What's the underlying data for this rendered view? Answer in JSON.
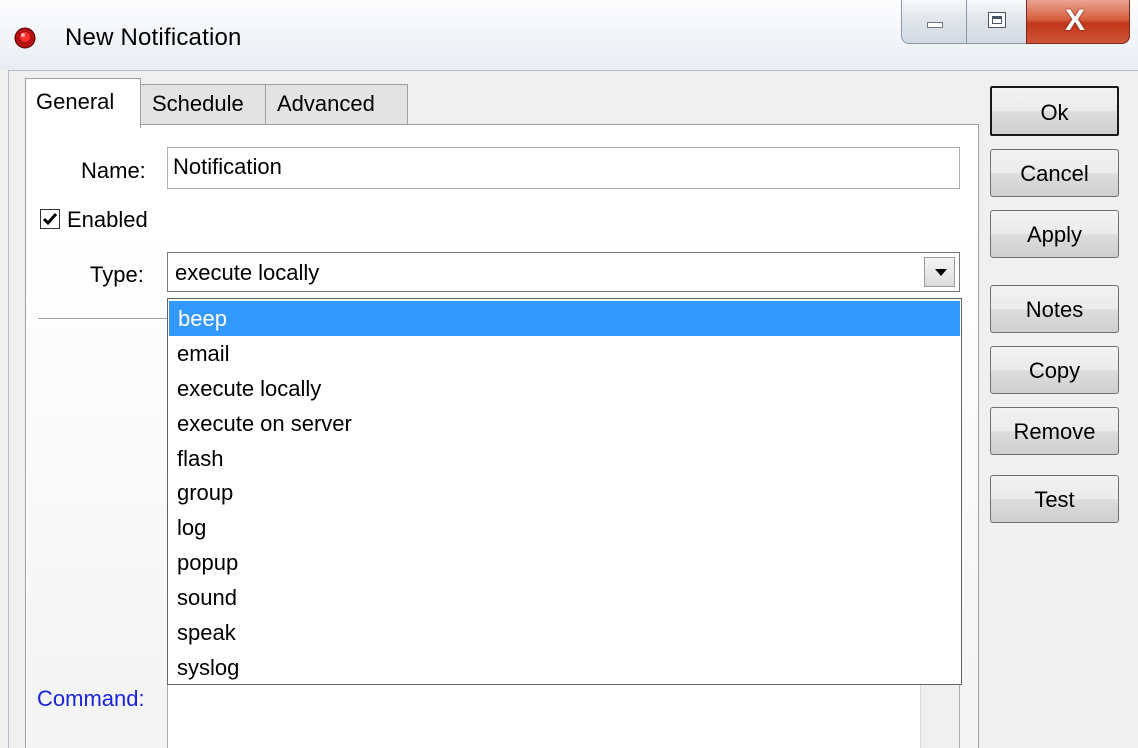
{
  "window": {
    "title": "New Notification",
    "app_icon": "red-alert-icon",
    "caption_buttons": {
      "minimize": "minimize-icon",
      "maximize": "maximize-icon",
      "close": "close-icon"
    }
  },
  "tabs": [
    {
      "label": "General",
      "active": true
    },
    {
      "label": "Schedule",
      "active": false
    },
    {
      "label": "Advanced",
      "active": false
    }
  ],
  "form": {
    "name_label": "Name:",
    "name_value": "Notification",
    "enabled_label": "Enabled",
    "enabled_checked": true,
    "type_label": "Type:",
    "type_value": "execute locally",
    "command_label": "Command:",
    "command_value": ""
  },
  "type_options": [
    "beep",
    "email",
    "execute locally",
    "execute on server",
    "flash",
    "group",
    "log",
    "popup",
    "sound",
    "speak",
    "syslog"
  ],
  "type_highlighted": "beep",
  "buttons": {
    "ok": "Ok",
    "cancel": "Cancel",
    "apply": "Apply",
    "notes": "Notes",
    "copy": "Copy",
    "remove": "Remove",
    "test": "Test"
  },
  "colors": {
    "selection": "#3399ff",
    "command_label": "#1a23d9",
    "close_button": "#c2361b"
  }
}
